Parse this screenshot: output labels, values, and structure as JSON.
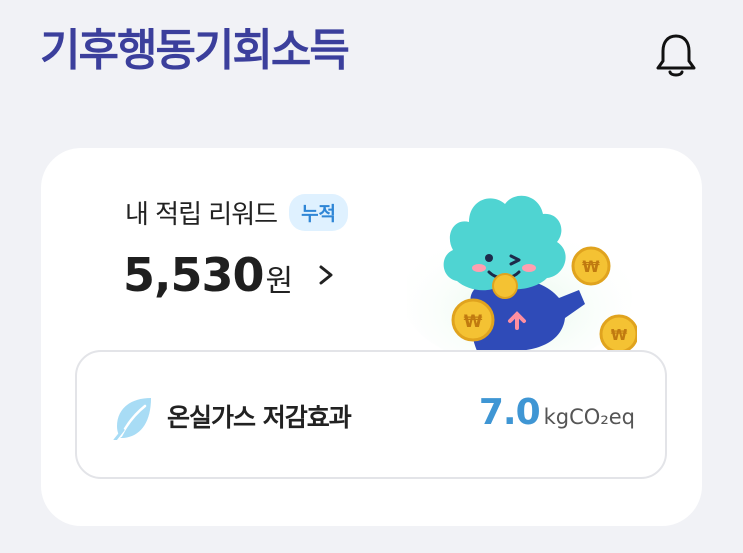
{
  "header": {
    "brand_title": "기후행동기회소득",
    "bell_icon": "bell-icon"
  },
  "reward_card": {
    "title": "내 적립 리워드",
    "badge": "누적",
    "amount": "5,530",
    "unit": "원",
    "arrow_icon": "chevron-right-icon",
    "mascot": "cloud-mascot-with-coins"
  },
  "emission": {
    "leaf_icon": "leaf-icon",
    "label": "온실가스 저감효과",
    "value": "7.0",
    "unit": "kgCO₂eq"
  },
  "colors": {
    "brand": "#3b3f9c",
    "accent_blue": "#3f96d4",
    "badge_bg": "#dff1ff",
    "badge_text": "#2f86d6",
    "mascot_teal": "#4fd4d2",
    "coin_gold": "#f4c233"
  }
}
